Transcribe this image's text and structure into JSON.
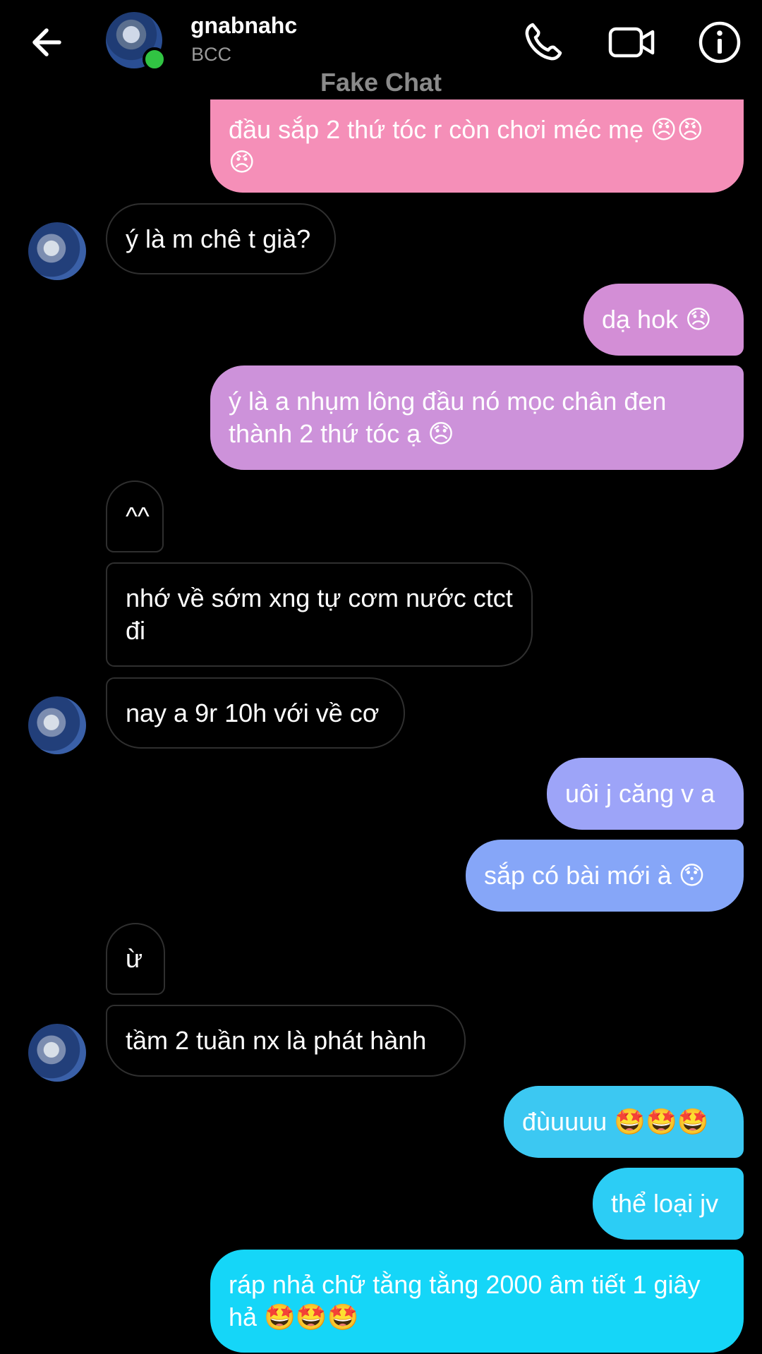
{
  "header": {
    "contact_name": "gnabnahc",
    "contact_sub": "BCC",
    "watermark": "Fake Chat",
    "icons": [
      "back-arrow-icon",
      "phone-icon",
      "video-camera-icon",
      "info-icon"
    ],
    "online_color": "#31c443"
  },
  "messages": [
    {
      "side": "out",
      "text": "đầu sắp 2 thứ tóc r còn chơi méc mẹ 😠😠😠",
      "color": "#f58fb8"
    },
    {
      "side": "in",
      "text": "ý là m chê t già?"
    },
    {
      "side": "out",
      "text": "dạ hok 😞",
      "color": "#d38ed6"
    },
    {
      "side": "out",
      "text": "ý là a nhụm lông đầu nó mọc chân đen thành 2 thứ tóc ạ 😞",
      "color": "#cd92da"
    },
    {
      "side": "in",
      "text": "^^"
    },
    {
      "side": "in",
      "text": "nhớ về sớm xng tự cơm nước ctct đi"
    },
    {
      "side": "in",
      "text": "nay a 9r 10h với về cơ"
    },
    {
      "side": "out",
      "text": "uôi j căng v a",
      "color": "#9da4f8"
    },
    {
      "side": "out",
      "text": "sắp có bài mới à 😯",
      "color": "#86a6f8"
    },
    {
      "side": "in",
      "text": "ừ"
    },
    {
      "side": "in",
      "text": "tầm 2 tuần nx là phát hành"
    },
    {
      "side": "out",
      "text": "đùuuuu 🤩🤩🤩",
      "color": "#3cc8f2"
    },
    {
      "side": "out",
      "text": "thể loại jv",
      "color": "#2ccdf5"
    },
    {
      "side": "out",
      "text": "ráp nhả chữ tằng tằng 2000 âm tiết 1 giây hả 🤩🤩🤩",
      "color": "#15d6f8"
    }
  ]
}
